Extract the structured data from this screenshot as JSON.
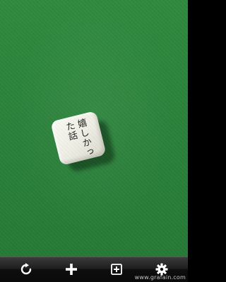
{
  "die": {
    "face_columns": [
      "嬉しかっ",
      "た話"
    ]
  },
  "toolbar": {
    "buttons": [
      {
        "icon": "refresh-icon"
      },
      {
        "icon": "plus-icon"
      },
      {
        "icon": "add-box-icon"
      },
      {
        "icon": "gear-icon"
      }
    ]
  },
  "watermark": "www.grafain.com",
  "colors": {
    "felt": "#2a823a",
    "die_face": "#f4f4ec",
    "toolbar": "#141414",
    "icon": "#ffffff"
  }
}
